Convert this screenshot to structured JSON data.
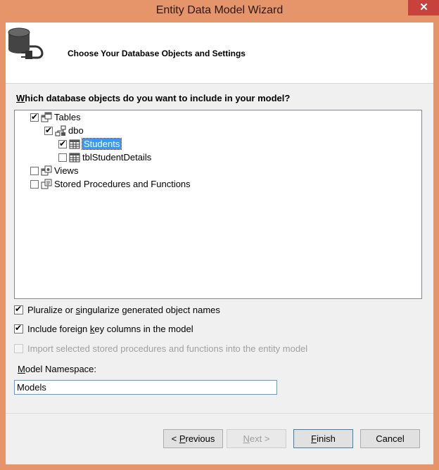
{
  "window": {
    "title": "Entity Data Model Wizard",
    "close_glyph": "✕"
  },
  "header": {
    "title": "Choose Your Database Objects and Settings",
    "icon": "database-plug-icon"
  },
  "question": {
    "mnemonic": "W",
    "rest": "hich database objects do you want to include in your model?"
  },
  "tree": {
    "tables": {
      "label": "Tables",
      "checked": true
    },
    "dbo": {
      "label": "dbo",
      "checked": true
    },
    "students": {
      "label": "Students",
      "checked": true,
      "selected": true
    },
    "tbl_student_details": {
      "label": "tblStudentDetails",
      "checked": false
    },
    "views": {
      "label": "Views",
      "checked": false
    },
    "stored_procs": {
      "label": "Stored Procedures and Functions",
      "checked": false
    }
  },
  "options": {
    "pluralize": {
      "pre": "Pluralize or ",
      "mnemonic": "s",
      "post": "ingularize generated object names",
      "checked": true
    },
    "foreign_keys": {
      "pre": "Include foreign ",
      "mnemonic": "k",
      "post": "ey columns in the model",
      "checked": true
    },
    "import_procs": {
      "label": "Import selected stored procedures and functions into the entity model",
      "checked": false,
      "enabled": false
    }
  },
  "namespace": {
    "mnemonic": "M",
    "rest": "odel Namespace:",
    "value": "Models"
  },
  "buttons": {
    "previous": {
      "pre": "< ",
      "mnemonic": "P",
      "post": "revious"
    },
    "next": {
      "mnemonic": "N",
      "post": "ext >"
    },
    "finish": {
      "mnemonic": "F",
      "post": "inish"
    },
    "cancel": {
      "label": "Cancel"
    }
  },
  "colors": {
    "selection": "#3399ff",
    "title_bar": "#e6946a",
    "close_button": "#c7413d"
  }
}
